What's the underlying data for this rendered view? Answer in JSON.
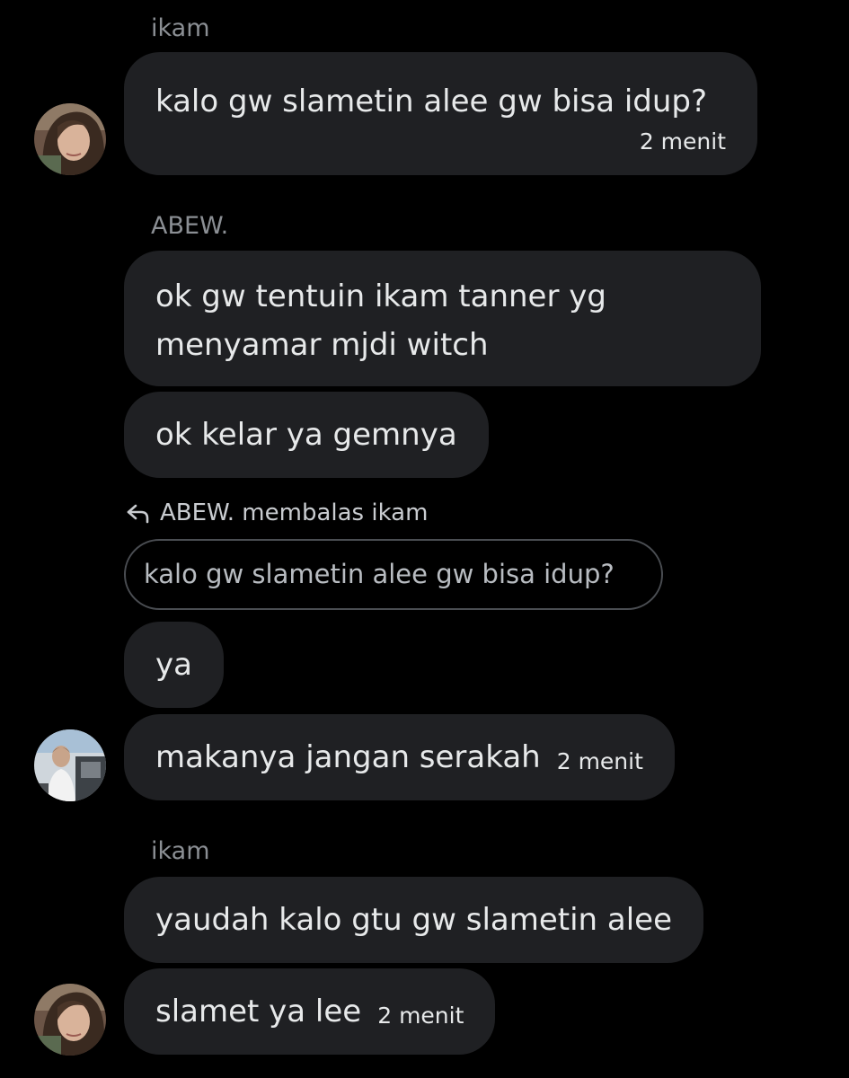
{
  "messages": [
    {
      "sender": "ikam",
      "text": "kalo gw slametin alee gw bisa idup?",
      "time": "2 menit"
    },
    {
      "sender": "ABEW.",
      "text": "ok gw tentuin ikam tanner yg menyamar mjdi witch"
    },
    {
      "text": "ok kelar ya gemnya"
    },
    {
      "reply_label": "ABEW. membalas ikam",
      "quoted": "kalo gw slametin alee gw bisa idup?",
      "text": "ya"
    },
    {
      "text": "makanya jangan serakah",
      "time": "2 menit"
    },
    {
      "sender": "ikam",
      "text": "yaudah kalo gtu gw slametin alee"
    },
    {
      "text": "slamet ya lee",
      "time": "2 menit"
    }
  ],
  "icons": {
    "reply": "reply-arrow-icon"
  }
}
